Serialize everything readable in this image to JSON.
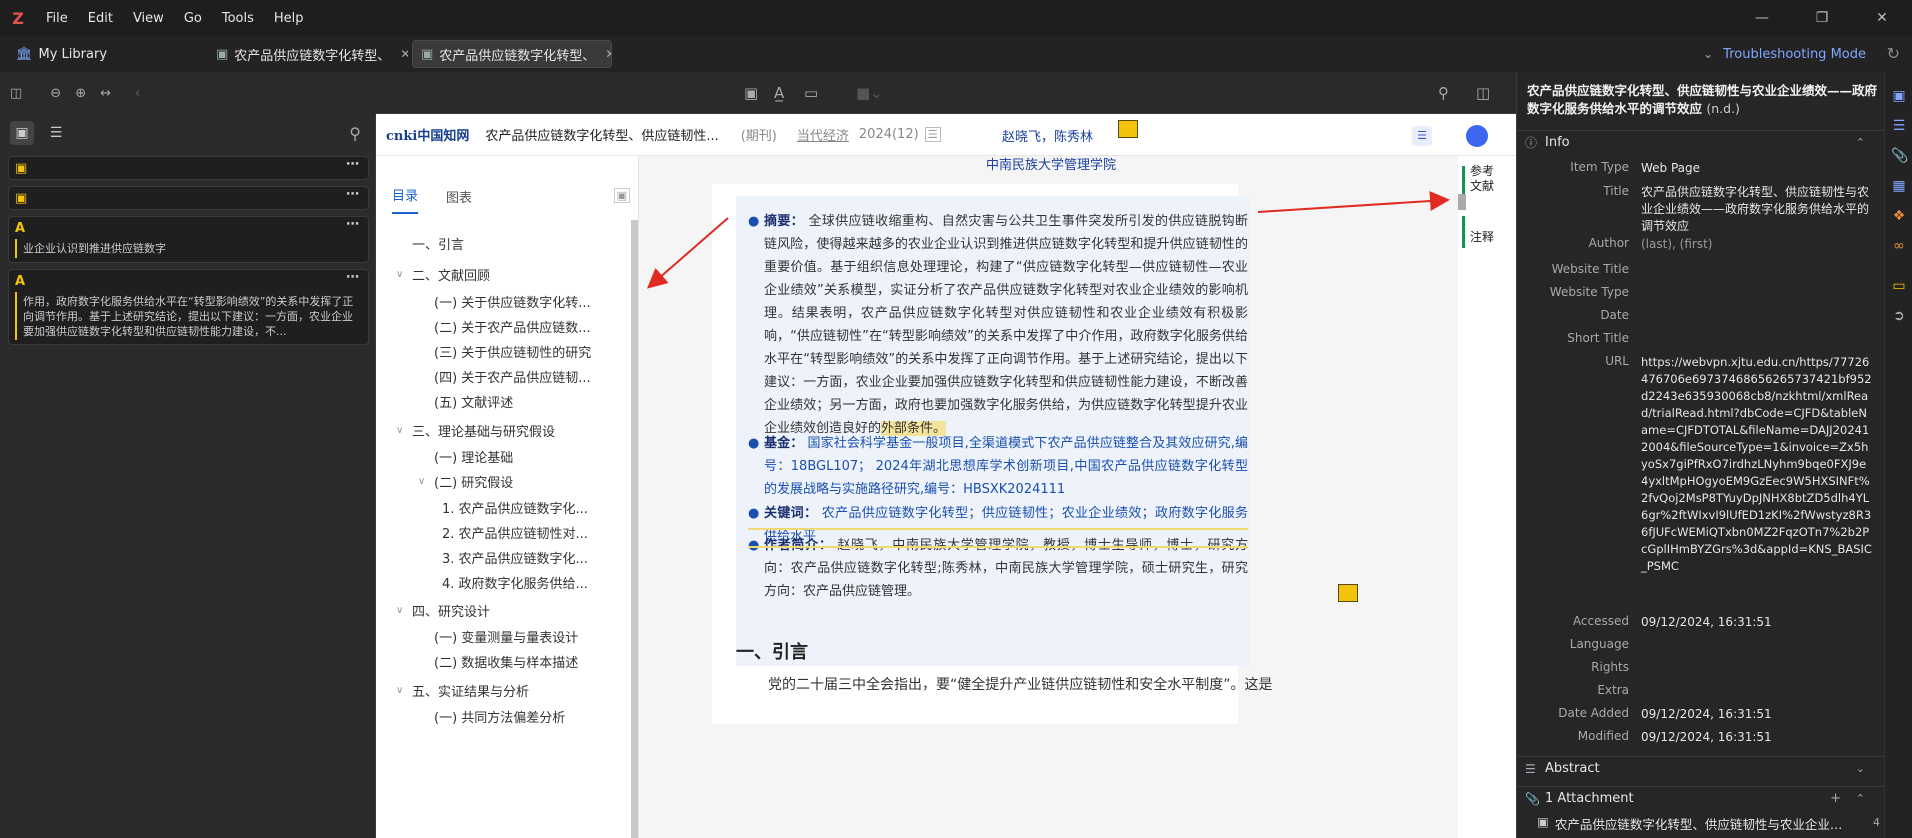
{
  "menu": {
    "logo": "Z",
    "items": [
      "File",
      "Edit",
      "View",
      "Go",
      "Tools",
      "Help"
    ]
  },
  "tabs": {
    "library": "My Library",
    "doc1": "农产品供应链数字化转型、",
    "doc2": "农产品供应链数字化转型、",
    "troubleshooting": "Troubleshooting Mode"
  },
  "annotations": [
    {
      "type": "note",
      "text": ""
    },
    {
      "type": "note",
      "text": ""
    },
    {
      "type": "text",
      "text": "业企业认识到推进供应链数字"
    },
    {
      "type": "text",
      "text": "作用，政府数字化服务供给水平在“转型影响绩效”的关系中发挥了正向调节作用。基于上述研究结论，提出以下建议：一方面，农业企业要加强供应链数字化转型和供应链韧性能力建设，不..."
    }
  ],
  "cnki": {
    "logo": "cnki中国知网",
    "title": "农产品供应链数字化转型、供应链韧性...",
    "type": "(期刊)",
    "journal": "当代经济",
    "issue": "2024(12)"
  },
  "toc": {
    "tabs": [
      "目录",
      "图表"
    ],
    "items": [
      {
        "text": "一、引言",
        "level": 0,
        "chev": false
      },
      {
        "text": "二、文献回顾",
        "level": 0,
        "chev": true
      },
      {
        "text": "(一) 关于供应链数字化转...",
        "level": 1,
        "chev": false
      },
      {
        "text": "(二) 关于农产品供应链数...",
        "level": 1,
        "chev": false
      },
      {
        "text": "(三) 关于供应链韧性的研究",
        "level": 1,
        "chev": false
      },
      {
        "text": "(四) 关于农产品供应链韧...",
        "level": 1,
        "chev": false
      },
      {
        "text": "(五) 文献评述",
        "level": 1,
        "chev": false
      },
      {
        "text": "三、理论基础与研究假设",
        "level": 0,
        "chev": true
      },
      {
        "text": "(一) 理论基础",
        "level": 1,
        "chev": false
      },
      {
        "text": "(二) 研究假设",
        "level": 1,
        "chev": true
      },
      {
        "text": "1. 农产品供应链数字化...",
        "level": 2,
        "chev": false
      },
      {
        "text": "2. 农产品供应链韧性对...",
        "level": 2,
        "chev": false
      },
      {
        "text": "3. 农产品供应链数字化...",
        "level": 2,
        "chev": false
      },
      {
        "text": "4. 政府数字化服务供给...",
        "level": 2,
        "chev": false
      },
      {
        "text": "四、研究设计",
        "level": 0,
        "chev": true
      },
      {
        "text": "(一) 变量测量与量表设计",
        "level": 1,
        "chev": false
      },
      {
        "text": "(二) 数据收集与样本描述",
        "level": 1,
        "chev": false
      },
      {
        "text": "五、实证结果与分析",
        "level": 0,
        "chev": true
      },
      {
        "text": "(一) 共同方法偏差分析",
        "level": 1,
        "chev": false
      }
    ]
  },
  "paper": {
    "authors": "赵晓飞，陈秀林",
    "affiliation": "中南民族大学管理学院",
    "abstract_label": "摘要：",
    "abstract": "全球供应链收缩重构、自然灾害与公共卫生事件突发所引发的供应链脱钩断链风险，使得越来越多的农业企业认识到推进供应链数字化转型和提升供应链韧性的重要价值。基于组织信息处理理论，构建了“供应链数字化转型—供应链韧性—农业企业绩效”关系模型，实证分析了农产品供应链数字化转型对农业企业绩效的影响机理。结果表明，农产品供应链数字化转型对供应链韧性和农业企业绩效有积极影响，“供应链韧性”在“转型影响绩效”的关系中发挥了中介作用，政府数字化服务供给水平在“转型影响绩效”的关系中发挥了正向调节作用。基于上述研究结论，提出以下建议：一方面，农业企业要加强供应链数字化转型和供应链韧性能力建设，不断改善企业绩效；另一方面，政府也要加强数字化服务供给，为供应链数字化转型提升农业企业绩效创造良好的",
    "abstract_hl": "外部条件。",
    "fund_label": "基金：",
    "fund": "国家社会科学基金一般项目,全渠道模式下农产品供应链整合及其效应研究,编号：18BGL107； 2024年湖北思想库学术创新项目,中国农产品供应链数字化转型的发展战略与实施路径研究,编号：HBSXK2024111",
    "keywords_label": "关键词：",
    "keywords": "农产品供应链数字化转型；供应链韧性；农业企业绩效；政府数字化服务供给水平",
    "author_label": "作者简介：",
    "author_info": "赵晓飞，中南民族大学管理学院，教授，博士生导师，博士，研究方向：农产品供应链数字化转型;陈秀林，中南民族大学管理学院，硕士研究生，研究方向：农产品供应链管理。",
    "section_title": "一、引言",
    "body_start": "党的二十届三中全会指出，要“健全提升产业链供应链韧性和安全水平制度”。这是"
  },
  "rail": {
    "ref": "参考文献",
    "note": "注释"
  },
  "item": {
    "title": "农产品供应链数字化转型、供应链韧性与农业企业绩效——政府数字化服务供给水平的调节效应",
    "title_suffix": "(n.d.)",
    "section_info": "Info",
    "fields": [
      {
        "label": "Item Type",
        "value": "Web Page"
      },
      {
        "label": "Title",
        "value": "农产品供应链数字化转型、供应链韧性与农业企业绩效——政府数字化服务供给水平的调节效应"
      },
      {
        "label": "Author",
        "value": "(last), (first)"
      },
      {
        "label": "Website Title",
        "value": ""
      },
      {
        "label": "Website Type",
        "value": ""
      },
      {
        "label": "Date",
        "value": ""
      },
      {
        "label": "Short Title",
        "value": ""
      },
      {
        "label": "URL",
        "value": "https://webvpn.xjtu.edu.cn/https/77726476706e69737468656265737421bf952d2243e635930068cb8/nzkhtml/xmlRead/trialRead.html?dbCode=CJFD&tableName=CJFDTOTAL&fileName=DAJJ202412004&fileSourceType=1&invoice=Zx5hyoSx7giPfRxO7irdhzLNyhm9bqe0FXJ9e4yxltMpHOgyoEM9GzEec9W5HXSINFt%2fvQoj2MsP8TYuyDpJNHX8btZD5dlh4YL6gr%2ftWIxvI9lUfED1zKI%2fWwstyz8R36fJUFcWEMiQTxbn0MZ2FqzOTn7%2b2PcGplIHmBYZGrs%3d&appId=KNS_BASIC_PSMC"
      },
      {
        "label": "Accessed",
        "value": "09/12/2024, 16:31:51"
      },
      {
        "label": "Language",
        "value": ""
      },
      {
        "label": "Rights",
        "value": ""
      },
      {
        "label": "Extra",
        "value": ""
      },
      {
        "label": "Date Added",
        "value": "09/12/2024, 16:31:51"
      },
      {
        "label": "Modified",
        "value": "09/12/2024, 16:31:51"
      }
    ],
    "section_abstract": "Abstract",
    "section_attachment": "1 Attachment",
    "attachment_name": "农产品供应链数字化转型、供应链韧性与农业企业绩效——政府数字化服务供给水平的调节效应",
    "attachment_count": "4"
  },
  "colors": {
    "accent": "#7ea6ff",
    "highlight": "#f3c20c",
    "cnki_blue": "#1a4fb0",
    "arrow": "#e02a22"
  }
}
